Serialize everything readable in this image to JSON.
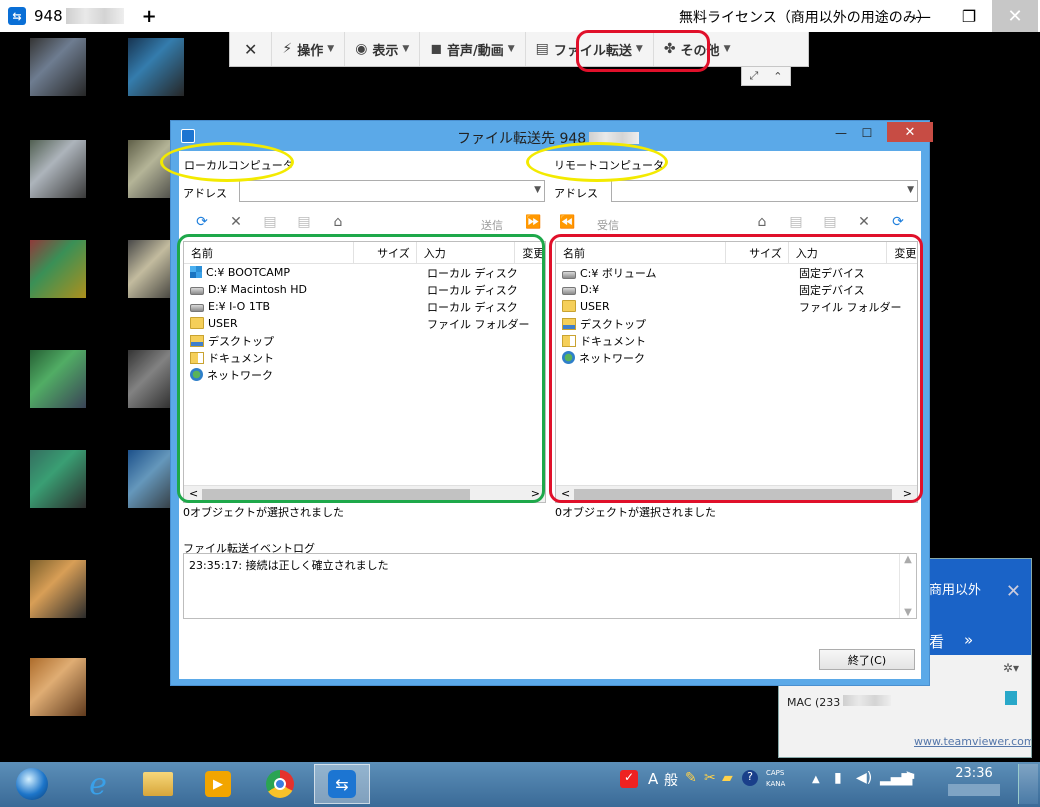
{
  "outer": {
    "session_prefix": "948",
    "add_tab": "+",
    "license": "無料ライセンス（商用以外の用途のみ）",
    "minimize": "—",
    "restore": "❐",
    "close": "✕"
  },
  "toolbar": {
    "close_icon_glyph": "✕",
    "items": [
      {
        "icon": "bolt-icon",
        "glyph": "⚡",
        "label": "操作"
      },
      {
        "icon": "eye-icon",
        "glyph": "◉",
        "label": "表示"
      },
      {
        "icon": "audio-video-icon",
        "glyph": "◼",
        "label": "音声/動画"
      },
      {
        "icon": "file-transfer-icon",
        "glyph": "▤",
        "label": "ファイル転送"
      },
      {
        "icon": "puzzle-icon",
        "glyph": "✤",
        "label": "その他"
      }
    ],
    "arrow": "▼",
    "sub_fullscreen": "⤢",
    "sub_collapse": "⌃"
  },
  "ft": {
    "title": "ファイル転送先 948",
    "minimize": "—",
    "maximize": "☐",
    "close": "✕",
    "local_label": "ローカルコンピュータ",
    "remote_label": "リモートコンピュータ",
    "address_label": "アドレス",
    "send_label": "送信",
    "receive_label": "受信",
    "columns": {
      "name": "名前",
      "size": "サイズ",
      "type": "入力",
      "changed": "変更"
    },
    "local_rows": [
      {
        "icon": "windows-drive-icon",
        "name": "C:¥ BOOTCAMP",
        "type": "ローカル ディスク"
      },
      {
        "icon": "drive-icon",
        "name": "D:¥ Macintosh HD",
        "type": "ローカル ディスク"
      },
      {
        "icon": "drive-icon",
        "name": "E:¥ I-O 1TB",
        "type": "ローカル ディスク"
      },
      {
        "icon": "folder-icon",
        "name": "USER",
        "type": "ファイル フォルダー"
      },
      {
        "icon": "desktop-folder-icon",
        "name": "デスクトップ",
        "type": ""
      },
      {
        "icon": "documents-folder-icon",
        "name": "ドキュメント",
        "type": ""
      },
      {
        "icon": "network-icon",
        "name": "ネットワーク",
        "type": ""
      }
    ],
    "remote_rows": [
      {
        "icon": "drive-icon",
        "name": "C:¥ ボリューム",
        "type": "固定デバイス"
      },
      {
        "icon": "drive-icon",
        "name": "D:¥",
        "type": "固定デバイス"
      },
      {
        "icon": "folder-icon",
        "name": "USER",
        "type": "ファイル フォルダー"
      },
      {
        "icon": "desktop-folder-icon",
        "name": "デスクトップ",
        "type": ""
      },
      {
        "icon": "documents-folder-icon",
        "name": "ドキュメント",
        "type": ""
      },
      {
        "icon": "network-icon",
        "name": "ネットワーク",
        "type": ""
      }
    ],
    "local_status": "0オブジェクトが選択されました",
    "remote_status": "0オブジェクトが選択されました",
    "log_label": "ファイル転送イベントログ",
    "log_entry": "23:35:17: 接続は正しく確立されました",
    "close_button": "終了(C)"
  },
  "popup": {
    "text": "商用以外",
    "close": "✕",
    "view_glyph": "看",
    "arrow": "»",
    "mac_label": "MAC (233",
    "url": "www.teamviewer.com",
    "gear": "✲▾"
  },
  "taskbar": {
    "ime_a": "A",
    "ime_kan": "般",
    "caps": "CAPS",
    "kana": "KANA",
    "time": "23:36",
    "up_arrow": "▲"
  }
}
